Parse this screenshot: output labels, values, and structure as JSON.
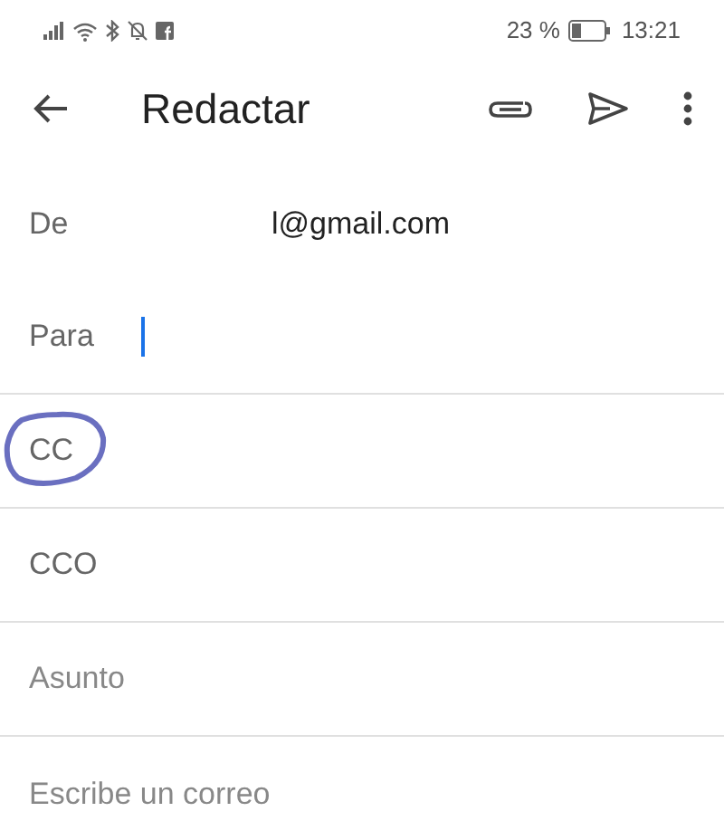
{
  "status_bar": {
    "battery": "23 %",
    "time": "13:21"
  },
  "app_bar": {
    "title": "Redactar"
  },
  "fields": [
    {
      "kind": "label",
      "label": "De",
      "value": "l@gmail.com",
      "divider": false
    },
    {
      "kind": "label",
      "label": "Para",
      "focused": true,
      "divider": true
    },
    {
      "kind": "label",
      "label": "CC",
      "circled": true,
      "divider": true
    },
    {
      "kind": "label",
      "label": "CCO",
      "divider": true
    },
    {
      "kind": "placeholder",
      "placeholder": "Asunto",
      "divider": true
    },
    {
      "kind": "placeholder",
      "placeholder": "Escribe un correo",
      "divider": false
    }
  ]
}
